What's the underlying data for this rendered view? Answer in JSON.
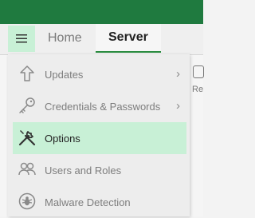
{
  "tabs": {
    "home": "Home",
    "server": "Server"
  },
  "ribbon": {
    "partial_label": "Re"
  },
  "menu": {
    "items": [
      {
        "label": "Updates",
        "icon": "arrow-up-icon",
        "has_submenu": true
      },
      {
        "label": "Credentials & Passwords",
        "icon": "key-icon",
        "has_submenu": true
      },
      {
        "label": "Options",
        "icon": "wrench-screwdriver-icon",
        "has_submenu": false,
        "selected": true
      },
      {
        "label": "Users and Roles",
        "icon": "users-icon",
        "has_submenu": false
      },
      {
        "label": "Malware Detection",
        "icon": "bug-shield-icon",
        "has_submenu": false
      }
    ],
    "chevron": "›"
  },
  "colors": {
    "titlebar": "#1f7a3f",
    "highlight": "#c8f0d6",
    "tab_underline": "#2a8b3f"
  }
}
